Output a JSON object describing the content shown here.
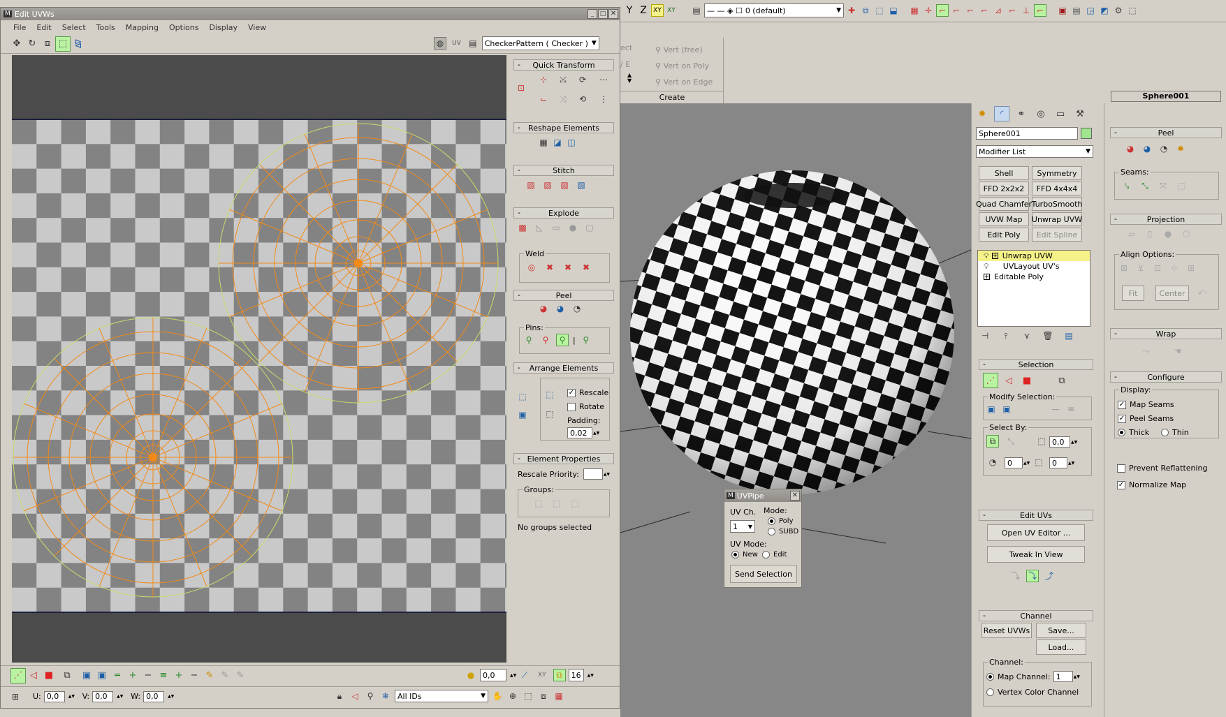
{
  "uv_editor": {
    "title": "Edit UVWs",
    "menu": [
      "File",
      "Edit",
      "Select",
      "Tools",
      "Mapping",
      "Options",
      "Display",
      "View"
    ],
    "uv_label": "UV",
    "checker_dropdown": "CheckerPattern  ( Checker )",
    "panels": {
      "quick_transform": "Quick Transform",
      "reshape": "Reshape Elements",
      "stitch": "Stitch",
      "explode": "Explode",
      "weld": "Weld",
      "peel": "Peel",
      "pins": "Pins:",
      "arrange": "Arrange Elements",
      "rescale": "Rescale",
      "rotate": "Rotate",
      "padding_label": "Padding:",
      "padding_value": "0,02",
      "element_props": "Element Properties",
      "rescale_priority": "Rescale Priority:",
      "groups": "Groups:",
      "no_groups": "No groups selected"
    },
    "bottom": {
      "value1": "0,0",
      "xy": "XY",
      "value2": "16",
      "u_label": "U:",
      "u_value": "0,0",
      "v_label": "V:",
      "v_value": "0,0",
      "w_label": "W:",
      "w_value": "0,0",
      "ids": "All IDs"
    }
  },
  "main_toolbar": {
    "y": "Y",
    "z": "Z",
    "xy": "XY",
    "xy2": "XY",
    "layer": "0 (default)"
  },
  "create_panel": {
    "items": [
      "Vert (free)",
      "Vert on Poly",
      "Vert on Edge"
    ],
    "partial_a": "ect",
    "partial_b": "/ E",
    "label": "Create"
  },
  "command_panel": {
    "object_name": "Sphere001",
    "header_name": "Sphere001",
    "modifier_list": "Modifier List",
    "modifier_buttons": [
      [
        "Shell",
        "Symmetry"
      ],
      [
        "FFD 2x2x2",
        "FFD 4x4x4"
      ],
      [
        "Quad Chamfer",
        "TurboSmooth"
      ],
      [
        "UVW Map",
        "Unwrap UVW"
      ],
      [
        "Edit Poly",
        "Edit Spline"
      ]
    ],
    "stack": [
      "Unwrap UVW",
      "UVLayout UV's",
      "Editable Poly"
    ],
    "selection": "Selection",
    "modify_selection": "Modify Selection:",
    "select_by": "Select By:",
    "select_by_value": "0,0",
    "select_by_v2": "0",
    "select_by_v3": "0",
    "edit_uvs": "Edit UVs",
    "open_uv_editor": "Open UV Editor ...",
    "tweak": "Tweak In View",
    "channel": "Channel",
    "reset_uvws": "Reset UVWs",
    "save": "Save...",
    "load": "Load...",
    "channel_label": "Channel:",
    "map_channel": "Map Channel:",
    "map_channel_value": "1",
    "vertex_color": "Vertex Color Channel"
  },
  "right_panel": {
    "peel": "Peel",
    "seams": "Seams:",
    "projection": "Projection",
    "align_options": "Align Options:",
    "fit": "Fit",
    "center": "Center",
    "wrap": "Wrap",
    "configure": "Configure",
    "display": "Display:",
    "map_seams": "Map Seams",
    "peel_seams": "Peel Seams",
    "thick": "Thick",
    "thin": "Thin",
    "prevent": "Prevent Reflattening",
    "normalize": "Normalize Map"
  },
  "uvpipe": {
    "title": "UVPipe",
    "uv_ch": "UV Ch.",
    "uv_ch_value": "1",
    "mode": "Mode:",
    "poly": "Poly",
    "subd": "SUBD",
    "uv_mode": "UV Mode:",
    "new": "New",
    "edit": "Edit",
    "send": "Send Selection"
  }
}
